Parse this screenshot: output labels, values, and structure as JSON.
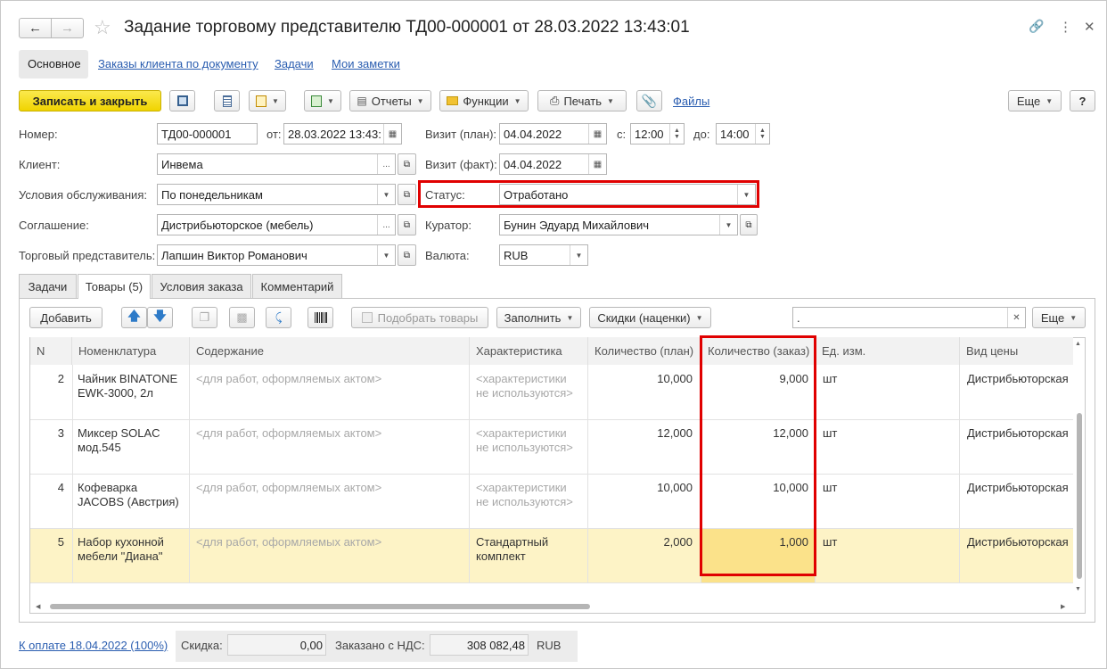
{
  "window": {
    "title": "Задание торговому представителю ТД00-000001 от 28.03.2022 13:43:01"
  },
  "nav_tabs": [
    "Основное",
    "Заказы клиента по документу",
    "Задачи",
    "Мои заметки"
  ],
  "toolbar": {
    "save_close": "Записать и закрыть",
    "reports": "Отчеты",
    "functions": "Функции",
    "print": "Печать",
    "files": "Файлы",
    "more": "Еще",
    "help": "?"
  },
  "form": {
    "number_label": "Номер:",
    "number": "ТД00-000001",
    "from_label": "от:",
    "from": "28.03.2022 13:43:",
    "visit_plan_label": "Визит (план):",
    "visit_plan": "04.04.2022",
    "from_time_label": "с:",
    "from_time": "12:00",
    "to_time_label": "до:",
    "to_time": "14:00",
    "client_label": "Клиент:",
    "client": "Инвема",
    "visit_fact_label": "Визит (факт):",
    "visit_fact": "04.04.2022",
    "service_label": "Условия обслуживания:",
    "service": "По понедельникам",
    "status_label": "Статус:",
    "status": "Отработано",
    "agreement_label": "Соглашение:",
    "agreement": "Дистрибьюторское (мебель)",
    "curator_label": "Куратор:",
    "curator": "Бунин Эдуард Михайлович",
    "agent_label": "Торговый представитель:",
    "agent": "Лапшин Виктор Романович",
    "currency_label": "Валюта:",
    "currency": "RUB"
  },
  "content_tabs": [
    "Задачи",
    "Товары (5)",
    "Условия заказа",
    "Комментарий"
  ],
  "table_toolbar": {
    "add": "Добавить",
    "pick": "Подобрать товары",
    "fill": "Заполнить",
    "discounts": "Скидки (наценки)",
    "search": ".",
    "more": "Еще"
  },
  "table": {
    "columns": [
      "N",
      "Номенклатура",
      "Содержание",
      "Характеристика",
      "Количество (план)",
      "Количество (заказ)",
      "Ед. изм.",
      "Вид цены"
    ],
    "rows": [
      {
        "n": "2",
        "item": "Чайник BINATONE EWK-3000,  2л",
        "content": "<для работ, оформляемых актом>",
        "char": "<характеристики не используются>",
        "qty_plan": "10,000",
        "qty_order": "9,000",
        "unit": "шт",
        "price_type": "Дистрибьюторская"
      },
      {
        "n": "3",
        "item": "Миксер SOLAC мод.545",
        "content": "<для работ, оформляемых актом>",
        "char": "<характеристики не используются>",
        "qty_plan": "12,000",
        "qty_order": "12,000",
        "unit": "шт",
        "price_type": "Дистрибьюторская"
      },
      {
        "n": "4",
        "item": "Кофеварка JACOBS (Австрия)",
        "content": "<для работ, оформляемых актом>",
        "char": "<характеристики не используются>",
        "qty_plan": "10,000",
        "qty_order": "10,000",
        "unit": "шт",
        "price_type": "Дистрибьюторская"
      },
      {
        "n": "5",
        "item": "Набор кухонной мебели \"Диана\"",
        "content": "<для работ, оформляемых актом>",
        "char": "Стандартный комплект",
        "qty_plan": "2,000",
        "qty_order": "1,000",
        "unit": "шт",
        "price_type": "Дистрибьюторская"
      }
    ]
  },
  "footer": {
    "payment_link": "К оплате 18.04.2022 (100%)",
    "discount_label": "Скидка:",
    "discount": "0,00",
    "ordered_label": "Заказано с НДС:",
    "ordered": "308 082,48",
    "currency": "RUB"
  },
  "colors": {
    "accent_yellow": "#f5dc1e",
    "highlight_red": "#e00000",
    "selected_row": "#fdf3c6",
    "link": "#2a5db0"
  }
}
